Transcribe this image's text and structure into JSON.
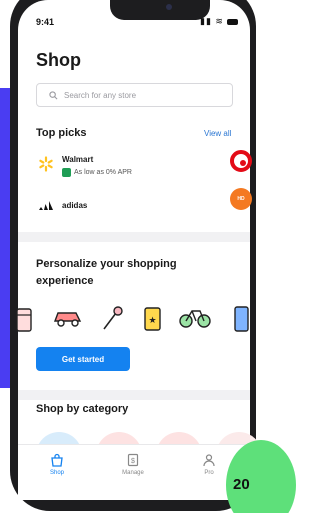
{
  "status": {
    "time": "9:41"
  },
  "header": {
    "title": "Shop"
  },
  "search": {
    "placeholder": "Search for any store"
  },
  "top_picks": {
    "title": "Top picks",
    "view_all": "View all",
    "items": [
      {
        "name": "Walmart",
        "subtitle": "As low as 0% APR"
      },
      {
        "name": "adidas"
      }
    ]
  },
  "personalize": {
    "title": "Personalize your shopping experience",
    "cta": "Get started"
  },
  "category": {
    "title": "Shop by category"
  },
  "nav": {
    "items": [
      "Shop",
      "Manage",
      "Pro"
    ]
  },
  "badge": {
    "text": "20"
  },
  "colors": {
    "accent": "#1482f0",
    "background_accent": "#4a3df2",
    "badge": "#5ee07a"
  },
  "icons": [
    "clothing-icon",
    "car-icon",
    "pin-icon",
    "ticket-icon",
    "bike-icon",
    "phone-icon"
  ]
}
